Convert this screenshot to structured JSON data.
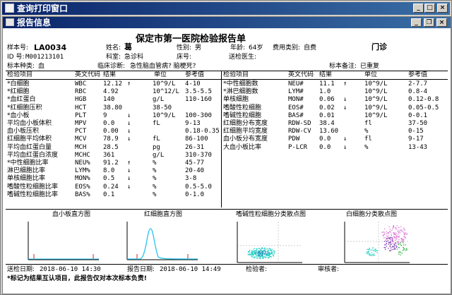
{
  "window": {
    "title": "查询打印窗口",
    "inner_title": "报告信息",
    "title_buttons": [
      "_",
      "□",
      "×"
    ],
    "inner_buttons": [
      "_",
      "❐",
      "×"
    ]
  },
  "report": {
    "hospital_title": "保定市第一医院检验报告单",
    "sample_no_label": "样本号:",
    "sample_no": "LA0034",
    "name_label": "姓名:",
    "name": "葛",
    "sex_label": "性别:",
    "sex": "男",
    "age_label": "年龄:",
    "age": "64岁",
    "fee_label": "费用类别:",
    "fee": "自费",
    "dept_type": "门诊",
    "id_label": "ID 号:",
    "id": "M001213101",
    "room_label": "科室:",
    "room": "急诊科",
    "bed_label": "床号:",
    "bed": "",
    "doctor_label": "送检医生:",
    "doctor": "",
    "specimen_label": "标本种类:",
    "specimen": "血",
    "diagnosis_label": "临床诊断:",
    "diagnosis": "急性脑血管病?  脑梗死?",
    "note_label": "标本备注:",
    "note": "已重复",
    "col_headers": {
      "item": "检验项目",
      "abbr": "英文代码",
      "result": "结果",
      "unit": "单位",
      "ref": "参考值"
    },
    "left_rows": [
      {
        "item": "*白细胞",
        "abbr": "WBC",
        "result": "12.12",
        "flag": "↑",
        "unit": "10^9/L",
        "ref": "4-10"
      },
      {
        "item": "*红细胞",
        "abbr": "RBC",
        "result": "4.92",
        "flag": "",
        "unit": "10^12/L",
        "ref": "3.5-5.5"
      },
      {
        "item": "*血红蛋白",
        "abbr": "HGB",
        "result": "140",
        "flag": "",
        "unit": "g/L",
        "ref": "110-160"
      },
      {
        "item": "*红细胞压积",
        "abbr": "HCT",
        "result": "38.80",
        "flag": "",
        "unit": "38-50",
        "ref": ""
      },
      {
        "item": "*血小板",
        "abbr": "PLT",
        "result": "9",
        "flag": "↓",
        "unit": "10^9/L",
        "ref": "100-300"
      },
      {
        "item": "平均血小板体积",
        "abbr": "MPV",
        "result": "0.0",
        "flag": "↓",
        "unit": "fL",
        "ref": "9-13"
      },
      {
        "item": "血小板压积",
        "abbr": "PCT",
        "result": "0.00",
        "flag": "↓",
        "unit": "",
        "ref": "0.18-0.35"
      },
      {
        "item": "红细胞平均体积",
        "abbr": "MCV",
        "result": "78.9",
        "flag": "↓",
        "unit": "fL",
        "ref": "86-100"
      },
      {
        "item": "平均血红蛋白量",
        "abbr": "MCH",
        "result": "28.5",
        "flag": "",
        "unit": "pg",
        "ref": "26-31"
      },
      {
        "item": "平均血红蛋白浓度",
        "abbr": "MCHC",
        "result": "361",
        "flag": "",
        "unit": "g/L",
        "ref": "310-370"
      },
      {
        "item": "*中性细胞比率",
        "abbr": "NEU%",
        "result": "91.2",
        "flag": "↑",
        "unit": "%",
        "ref": "45-77"
      },
      {
        "item": "淋巴细胞比率",
        "abbr": "LYM%",
        "result": "8.0",
        "flag": "↓",
        "unit": "%",
        "ref": "20-40"
      },
      {
        "item": "单核细胞比率",
        "abbr": "MON%",
        "result": "0.5",
        "flag": "↓",
        "unit": "%",
        "ref": "3-8"
      },
      {
        "item": "嗜酸性粒细胞比率",
        "abbr": "EOS%",
        "result": "0.24",
        "flag": "↓",
        "unit": "%",
        "ref": "0.5-5.0"
      },
      {
        "item": "嗜碱性粒细胞比率",
        "abbr": "BAS%",
        "result": "0.1",
        "flag": "",
        "unit": "%",
        "ref": "0-1.0"
      }
    ],
    "right_rows": [
      {
        "item": "*中性细胞数",
        "abbr": "NEU#",
        "result": "11.1",
        "flag": "↑",
        "unit": "10^9/L",
        "ref": "2-7.7"
      },
      {
        "item": "*淋巴细胞数",
        "abbr": "LYM#",
        "result": "1.0",
        "flag": "",
        "unit": "10^9/L",
        "ref": "0.8-4"
      },
      {
        "item": "单核细胞",
        "abbr": "MON#",
        "result": "0.06",
        "flag": "↓",
        "unit": "10^9/L",
        "ref": "0.12-0.8"
      },
      {
        "item": "嗜酸性粒细胞",
        "abbr": "EOS#",
        "result": "0.02",
        "flag": "↓",
        "unit": "10^9/L",
        "ref": "0.05-0.5"
      },
      {
        "item": "嗜碱性粒细胞",
        "abbr": "BAS#",
        "result": "0.01",
        "flag": "",
        "unit": "10^9/L",
        "ref": "0-0.1"
      },
      {
        "item": "红细胞分布宽度",
        "abbr": "RDW-SD",
        "result": "38.4",
        "flag": "",
        "unit": "fl",
        "ref": "37-50"
      },
      {
        "item": "红细胞平均宽度",
        "abbr": "RDW-CV",
        "result": "13.60",
        "flag": "",
        "unit": "%",
        "ref": "0-15"
      },
      {
        "item": "血小板分布宽度",
        "abbr": "PDW",
        "result": "0.0",
        "flag": "↓",
        "unit": "fl",
        "ref": "9-17"
      },
      {
        "item": "大血小板比率",
        "abbr": "P-LCR",
        "result": "0.0",
        "flag": "↓",
        "unit": "%",
        "ref": "13-43"
      }
    ],
    "charts": {
      "plt_title": "血小板直方图",
      "rbc_title": "红细胞直方图",
      "baso_title": "嗜碱性粒细胞分类散点图",
      "wbc_title": "白细胞分类散点图"
    },
    "footer": {
      "sent_label": "送检日期:",
      "sent_date": "2018-06-10  14:30",
      "report_label": "报告日期:",
      "report_date": "2018-06-10  14:49",
      "tester_label": "检验者:",
      "reviewer_label": "审核者:",
      "note": "*标记为结果互认项目，此报告仅对本次标本负责!"
    }
  },
  "colors": {
    "titlebar": "#0a246a",
    "histogram_line": "#27c4ee",
    "scatter_cyan": "#2ad1c6",
    "scatter_pink": "#e07ad7",
    "scatter_purple": "#7f3fb0",
    "scatter_green": "#38b34a"
  }
}
